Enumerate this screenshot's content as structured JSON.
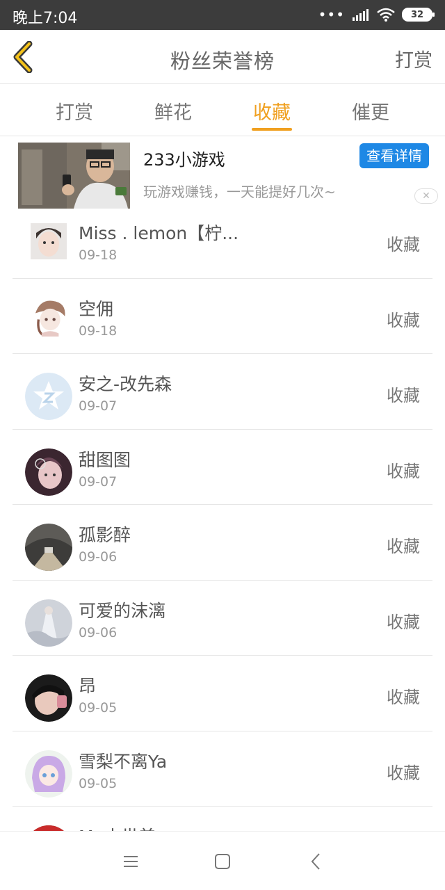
{
  "status_bar": {
    "time": "晚上7:04",
    "battery": "32"
  },
  "header": {
    "title": "粉丝荣誉榜",
    "reward_label": "打赏"
  },
  "tabs": [
    {
      "label": "打赏"
    },
    {
      "label": "鲜花"
    },
    {
      "label": "收藏"
    },
    {
      "label": "催更"
    }
  ],
  "ad": {
    "title": "233小游戏",
    "description": "玩游戏赚钱，一天能提好几次~",
    "button_label": "查看详情",
    "close_glyph": "✕"
  },
  "fans": [
    {
      "name": "Miss . lemon【柠...",
      "date": "09-18",
      "action": "收藏"
    },
    {
      "name": "空佣",
      "date": "09-18",
      "action": "收藏"
    },
    {
      "name": "安之-改先森",
      "date": "09-07",
      "action": "收藏"
    },
    {
      "name": "甜图图",
      "date": "09-07",
      "action": "收藏"
    },
    {
      "name": "孤影醉",
      "date": "09-06",
      "action": "收藏"
    },
    {
      "name": "可爱的沫漓",
      "date": "09-06",
      "action": "收藏"
    },
    {
      "name": "昂",
      "date": "09-05",
      "action": "收藏"
    },
    {
      "name": "雪梨不离Ya",
      "date": "09-05",
      "action": "收藏"
    },
    {
      "name": "My小世美er",
      "date": "",
      "action": ""
    }
  ],
  "colors": {
    "accent": "#f0a020",
    "ad_button": "#1e88e5",
    "status_bar": "#3c3c3c"
  }
}
